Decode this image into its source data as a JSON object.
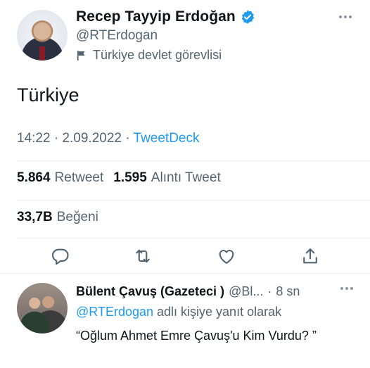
{
  "author": {
    "display_name": "Recep Tayyip Erdoğan",
    "handle": "@RTErdogan",
    "label": "Türkiye devlet görevlisi",
    "avatar_icon": "profile-photo",
    "verified_icon": "verified-badge-icon"
  },
  "tweet": {
    "text": "Türkiye",
    "time": "14:22",
    "date": "2.09.2022",
    "source": "TweetDeck"
  },
  "stats": {
    "retweets_value": "5.864",
    "retweets_label": "Retweet",
    "quotes_value": "1.595",
    "quotes_label": "Alıntı Tweet",
    "likes_value": "33,7B",
    "likes_label": "Beğeni"
  },
  "actions": [
    "reply-icon",
    "retweet-icon",
    "like-icon",
    "share-icon"
  ],
  "reply": {
    "display_name": "Bülent Çavuş (Gazeteci )",
    "handle": "@Bl...",
    "time": "8 sn",
    "reply_to_mention": "@RTErdogan",
    "reply_to_suffix": "adlı kişiye yanıt olarak",
    "text": "“Oğlum Ahmet Emre Çavuş'u Kim Vurdu? ”"
  },
  "colors": {
    "accent": "#1d9bf0",
    "text": "#0f1419",
    "muted": "#536471"
  }
}
